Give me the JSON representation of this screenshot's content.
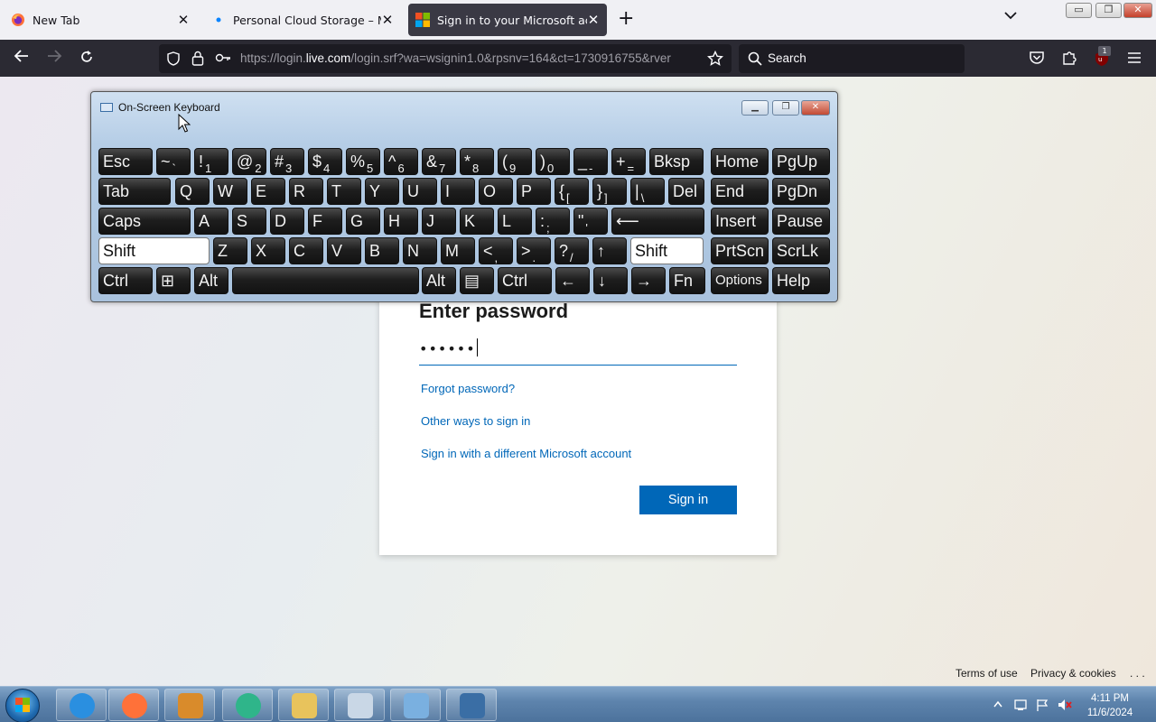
{
  "browser": {
    "tabs": [
      {
        "title": "New Tab",
        "favicon": "firefox-icon"
      },
      {
        "title": "Personal Cloud Storage – Micros",
        "favicon": "loading-dot-icon"
      },
      {
        "title": "Sign in to your Microsoft accou",
        "favicon": "microsoft-logo-icon"
      }
    ],
    "address_prefix": "https://login.",
    "address_domain": "live.com",
    "address_suffix": "/login.srf?wa=wsignin1.0&rpsnv=164&ct=1730916755&rver",
    "search_placeholder": "Search",
    "extension_badge": "1"
  },
  "osk": {
    "title": "On-Screen Keyboard",
    "rows": [
      [
        "Esc",
        "~`",
        "!1",
        "@2",
        "#3",
        "$4",
        "%5",
        "^6",
        "&7",
        "*8",
        "(9",
        ")0",
        "_-",
        "+=",
        "Bksp",
        "Home",
        "PgUp"
      ],
      [
        "Tab",
        "Q",
        "W",
        "E",
        "R",
        "T",
        "Y",
        "U",
        "I",
        "O",
        "P",
        "{[",
        "}]",
        "|\\",
        "Del",
        "End",
        "PgDn"
      ],
      [
        "Caps",
        "A",
        "S",
        "D",
        "F",
        "G",
        "H",
        "J",
        "K",
        "L",
        ":;",
        "\"'",
        "⟵",
        "Insert",
        "Pause"
      ],
      [
        "Shift",
        "Z",
        "X",
        "C",
        "V",
        "B",
        "N",
        "M",
        "<,",
        ">.",
        "?/",
        "↑",
        "Shift",
        "PrtScn",
        "ScrLk"
      ],
      [
        "Ctrl",
        "⊞",
        "Alt",
        "",
        "Alt",
        "▤",
        "Ctrl",
        "←",
        "↓",
        "→",
        "Fn",
        "Options",
        "Help"
      ]
    ]
  },
  "login": {
    "heading": "Enter password",
    "password_mask": "••••••",
    "forgot": "Forgot password?",
    "other_ways": "Other ways to sign in",
    "different_account": "Sign in with a different Microsoft account",
    "signin_button": "Sign in"
  },
  "footer": {
    "terms": "Terms of use",
    "privacy": "Privacy & cookies",
    "more": ". . ."
  },
  "taskbar": {
    "apps": [
      "internet-explorer-icon",
      "firefox-icon",
      "media-player-icon",
      "messenger-icon",
      "file-explorer-icon",
      "sticky-notes-icon",
      "control-panel-icon",
      "on-screen-keyboard-icon"
    ],
    "time": "4:11 PM",
    "date": "11/6/2024"
  },
  "colors": {
    "accent": "#0067b8",
    "browser_dark": "#2b2a33"
  }
}
